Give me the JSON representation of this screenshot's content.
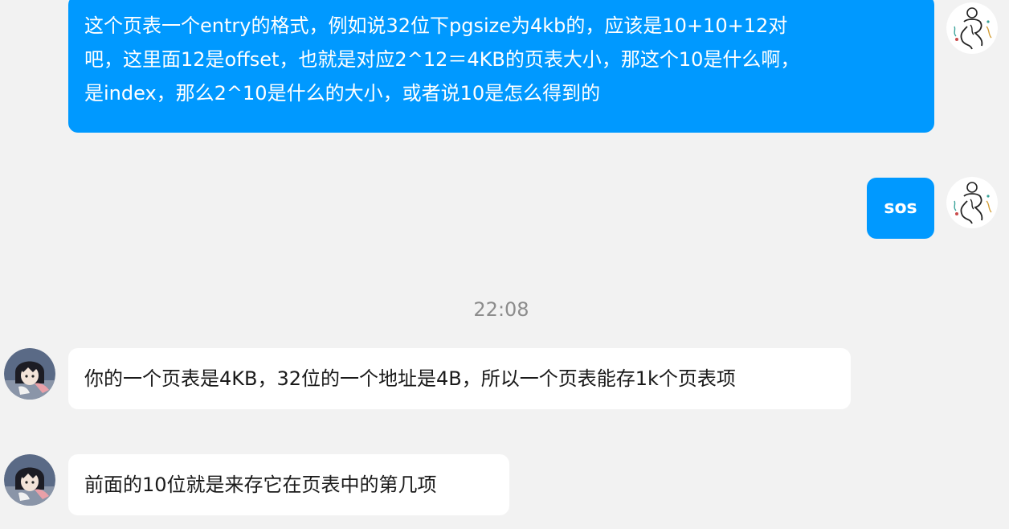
{
  "messages": [
    {
      "sender": "me",
      "lines": [
        "这个页表一个entry的格式，例如说32位下pgsize为4kb的，应该是10+10+12对",
        "吧，这里面12是offset，也就是对应2^12＝4KB的页表大小，那这个10是什么啊，",
        "是index，那么2^10是什么的大小，或者说10是怎么得到的"
      ]
    },
    {
      "sender": "me",
      "text": "sos"
    },
    {
      "sender": "peer",
      "text": "你的一个页表是4KB，32位的一个地址是4B，所以一个页表能存1k个页表项"
    },
    {
      "sender": "peer",
      "text": "前面的10位就是来存它在页表中的第几项"
    }
  ],
  "timestamp": "22:08",
  "colors": {
    "background": "#f2f2f2",
    "outgoing_bubble": "#0099ff",
    "incoming_bubble": "#ffffff",
    "timestamp_text": "#8c8c8c"
  },
  "icons": {
    "my_avatar": "sketch-figure-avatar",
    "peer_avatar": "anime-girl-avatar"
  }
}
